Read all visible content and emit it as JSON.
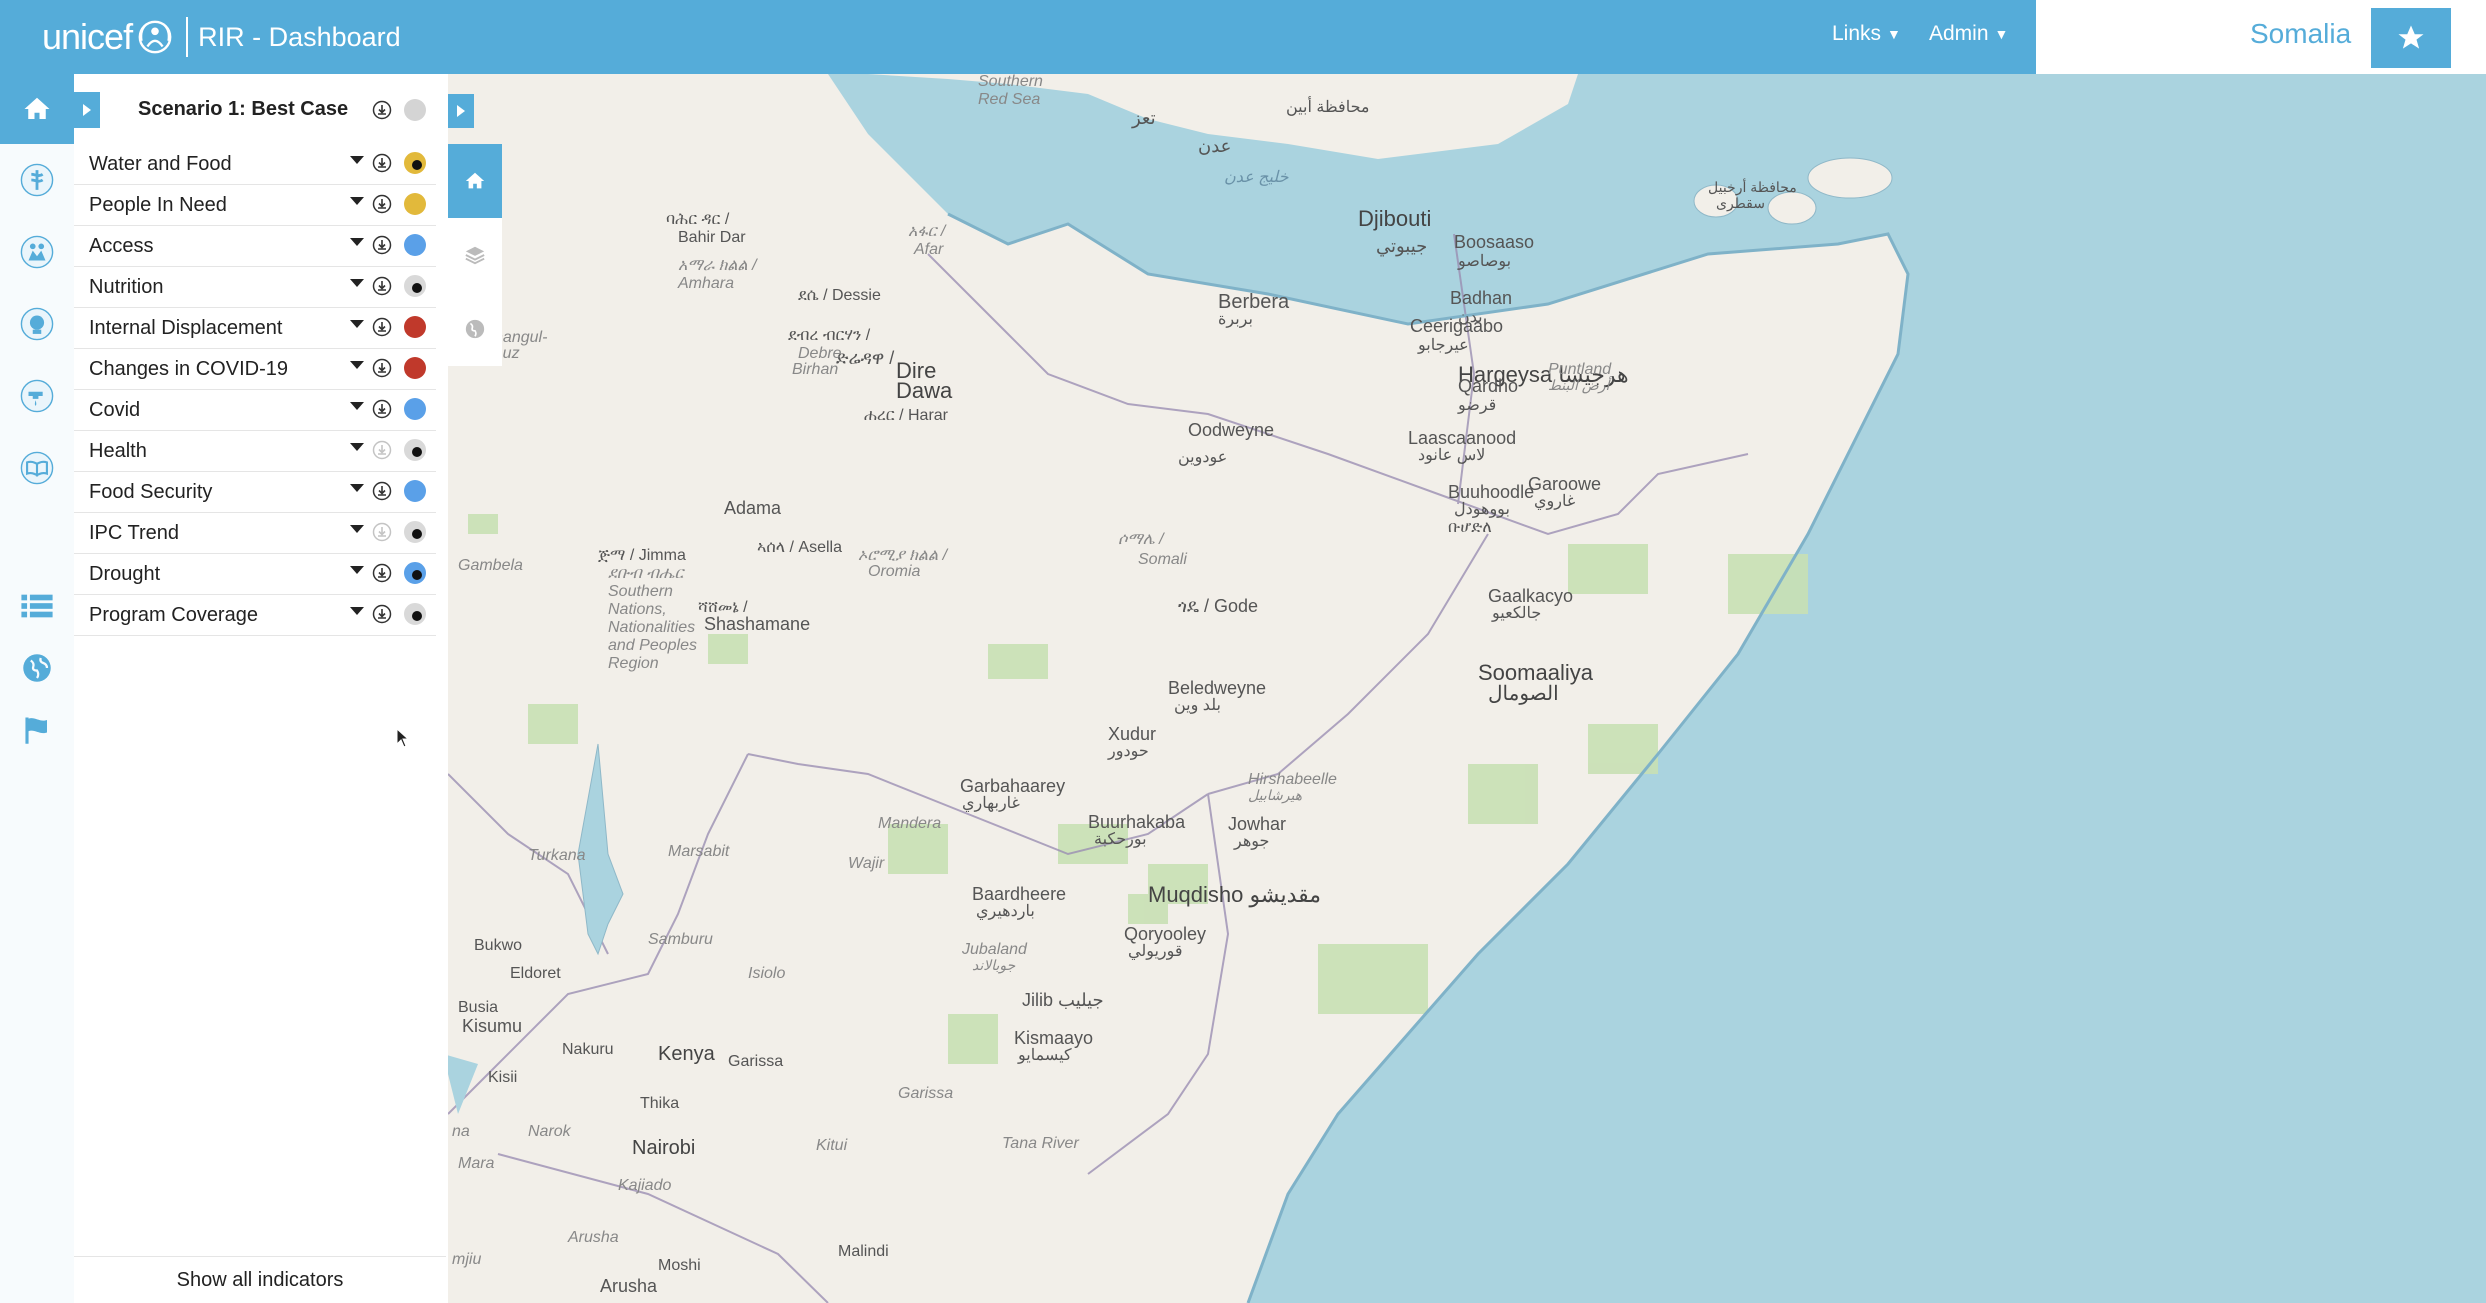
{
  "header": {
    "logo": "unicef",
    "title": "RIR - Dashboard",
    "links_label": "Links",
    "admin_label": "Admin",
    "country": "Somalia",
    "accent_color": "#55acd9"
  },
  "rail": {
    "items": [
      "home-icon",
      "health-icon",
      "child-protection-icon",
      "nutrition-icon",
      "wash-icon",
      "education-icon",
      "table-list-icon",
      "globe-icon",
      "flag-icon"
    ]
  },
  "panel": {
    "scenario_title": "Scenario 1: Best Case",
    "show_all_label": "Show all indicators",
    "indicators": [
      {
        "label": "Water and Food",
        "status_color": "#e2b93b",
        "inner_dot": true
      },
      {
        "label": "People In Need",
        "status_color": "#e2b93b",
        "inner_dot": false
      },
      {
        "label": "Access",
        "status_color": "#5aa0e8",
        "inner_dot": false
      },
      {
        "label": "Nutrition",
        "status_color": "#d9d9d9",
        "inner_dot": true
      },
      {
        "label": "Internal Displacement",
        "status_color": "#c0392b",
        "inner_dot": false
      },
      {
        "label": "Changes in COVID-19",
        "status_color": "#c0392b",
        "inner_dot": false
      },
      {
        "label": "Covid",
        "status_color": "#5aa0e8",
        "inner_dot": false
      },
      {
        "label": "Health",
        "status_color": "#d9d9d9",
        "inner_dot": true,
        "download_disabled": true
      },
      {
        "label": "Food Security",
        "status_color": "#5aa0e8",
        "inner_dot": false
      },
      {
        "label": "IPC Trend",
        "status_color": "#d9d9d9",
        "inner_dot": true,
        "download_disabled": true
      },
      {
        "label": "Drought",
        "status_color": "#5aa0e8",
        "inner_dot": true
      },
      {
        "label": "Program Coverage",
        "status_color": "#d9d9d9",
        "inner_dot": true
      }
    ]
  },
  "map": {
    "labels": [
      {
        "t": "Djibouti"
      },
      {
        "t": "جيبوتي"
      },
      {
        "t": "Hargeysa هرجيسا"
      },
      {
        "t": "Berbera"
      },
      {
        "t": "بربرة"
      },
      {
        "t": "Boosaaso"
      },
      {
        "t": "بوصاصو"
      },
      {
        "t": "Badhan"
      },
      {
        "t": "بدن"
      },
      {
        "t": "Ceerigaabo"
      },
      {
        "t": "عيرجابو"
      },
      {
        "t": "Qardho"
      },
      {
        "t": "قرضو"
      },
      {
        "t": "Puntland"
      },
      {
        "t": "أرض البنط"
      },
      {
        "t": "Laascaanood"
      },
      {
        "t": "لاس عانود"
      },
      {
        "t": "Garoowe"
      },
      {
        "t": "غاروي"
      },
      {
        "t": "Buuhoodle"
      },
      {
        "t": "بووهودل"
      },
      {
        "t": "ቡሆድለ"
      },
      {
        "t": "Gaalkacyo"
      },
      {
        "t": "جالكعيو"
      },
      {
        "t": "Soomaaliya"
      },
      {
        "t": "الصومال"
      },
      {
        "t": "Beledweyne"
      },
      {
        "t": "بلد وين"
      },
      {
        "t": "Xudur"
      },
      {
        "t": "حودور"
      },
      {
        "t": "Hirshabeelle"
      },
      {
        "t": "هيرشابيل"
      },
      {
        "t": "Jowhar"
      },
      {
        "t": "جوهر"
      },
      {
        "t": "Garbahaarey"
      },
      {
        "t": "غاربهاري"
      },
      {
        "t": "Buurhakaba"
      },
      {
        "t": "بورحكبة"
      },
      {
        "t": "Muqdisho مقديشو"
      },
      {
        "t": "Baardheere"
      },
      {
        "t": "باردهيري"
      },
      {
        "t": "Qoryooley"
      },
      {
        "t": "قوريولي"
      },
      {
        "t": "Jubaland"
      },
      {
        "t": "جوبالاند"
      },
      {
        "t": "Jilib جيليب"
      },
      {
        "t": "Kismaayo"
      },
      {
        "t": "كيسمايو"
      },
      {
        "t": "Dire"
      },
      {
        "t": "Dawa"
      },
      {
        "t": "ድሬዳዋ /"
      },
      {
        "t": "ሐረር / Harar"
      },
      {
        "t": "Oodweyne"
      },
      {
        "t": "عودوين"
      },
      {
        "t": "ጎዴ / Gode"
      },
      {
        "t": "ሶማሌ /"
      },
      {
        "t": "Somali"
      },
      {
        "t": "Adama"
      },
      {
        "t": "ኣሰላ / Asella"
      },
      {
        "t": "ኦሮሚያ ክልል /"
      },
      {
        "t": "Oromia"
      },
      {
        "t": "Shashamane"
      },
      {
        "t": "ሻሸመኔ /"
      },
      {
        "t": "ጅማ / Jimma"
      },
      {
        "t": "Gambela"
      },
      {
        "t": "ደቡብ ብሔር"
      },
      {
        "t": "Southern"
      },
      {
        "t": "Nations,"
      },
      {
        "t": "Nationalities"
      },
      {
        "t": "and Peoples"
      },
      {
        "t": "Region"
      },
      {
        "t": "ባሕር ዳር /"
      },
      {
        "t": "Bahir Dar"
      },
      {
        "t": "አማራ ክልል /"
      },
      {
        "t": "Amhara"
      },
      {
        "t": "ደሴ / Dessie"
      },
      {
        "t": "ደብረ ብርሃን /"
      },
      {
        "t": "Debre"
      },
      {
        "t": "Birhan"
      },
      {
        "t": "አፋር /"
      },
      {
        "t": "Afar"
      },
      {
        "t": "Benishangul-"
      },
      {
        "t": "Gumuz"
      },
      {
        "t": "Southern"
      },
      {
        "t": "Red Sea"
      },
      {
        "t": "تعز"
      },
      {
        "t": "عدن"
      },
      {
        "t": "محافظة أبين"
      },
      {
        "t": "خليج عدن"
      },
      {
        "t": "محافظة أرخبيل"
      },
      {
        "t": "سقطرى"
      },
      {
        "t": "Mandera"
      },
      {
        "t": "Wajir"
      },
      {
        "t": "Marsabit"
      },
      {
        "t": "Turkana"
      },
      {
        "t": "Samburu"
      },
      {
        "t": "Isiolo"
      },
      {
        "t": "Garissa"
      },
      {
        "t": "Garissa"
      },
      {
        "t": "Tana River"
      },
      {
        "t": "Kitui"
      },
      {
        "t": "Bukwo"
      },
      {
        "t": "Eldoret"
      },
      {
        "t": "Busia"
      },
      {
        "t": "Kisumu"
      },
      {
        "t": "Nakuru"
      },
      {
        "t": "Kenya"
      },
      {
        "t": "Kisii"
      },
      {
        "t": "Narok"
      },
      {
        "t": "Thika"
      },
      {
        "t": "Nairobi"
      },
      {
        "t": "Kajiado"
      },
      {
        "t": "Mara"
      },
      {
        "t": "Arusha"
      },
      {
        "t": "Arusha"
      },
      {
        "t": "Moshi"
      },
      {
        "t": "Malindi"
      },
      {
        "t": "mjiu"
      },
      {
        "t": "na"
      }
    ]
  }
}
